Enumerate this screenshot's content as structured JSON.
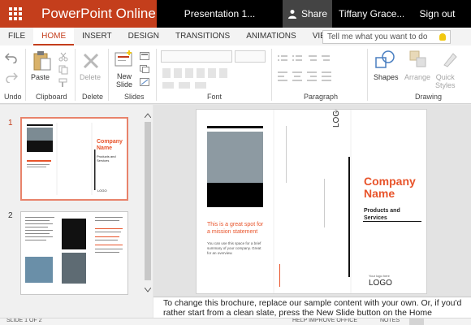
{
  "titlebar": {
    "app_name": "PowerPoint Online",
    "doc_name": "Presentation 1...",
    "share_label": "Share",
    "user_name": "Tiffany Grace...",
    "signout_label": "Sign out"
  },
  "tabs": [
    "FILE",
    "HOME",
    "INSERT",
    "DESIGN",
    "TRANSITIONS",
    "ANIMATIONS",
    "VIEW"
  ],
  "active_tab": "HOME",
  "tellme_placeholder": "Tell me what you want to do",
  "ribbon": {
    "undo_label": "Undo",
    "paste_label": "Paste",
    "clipboard_label": "Clipboard",
    "delete_btn": "Delete",
    "delete_group": "Delete",
    "new_slide_1": "New",
    "new_slide_2": "Slide",
    "slides_group": "Slides",
    "font_group": "Font",
    "paragraph_group": "Paragraph",
    "shapes_label": "Shapes",
    "arrange_label": "Arrange",
    "quick_styles_1": "Quick",
    "quick_styles_2": "Styles",
    "drawing_group": "Drawing"
  },
  "thumbnails": [
    {
      "number": "1",
      "company": "Company Name",
      "sub": "Products and Services",
      "logo": "LOGO"
    },
    {
      "number": "2"
    }
  ],
  "slide": {
    "company_name_1": "Company",
    "company_name_2": "Name",
    "products": "Products and Services",
    "mission": "This is a great spot for a mission statement",
    "body_text": "You can use this space for a brief summary of your company. Great for an overview.",
    "logo_top": "LOGO",
    "logo_bottom": "LOGO",
    "your_logo": "Your logo here"
  },
  "notes_text": "To change this brochure, replace our sample content with your own. Or, if you'd rather start from a clean slate, press the New Slide button on the Home",
  "status": {
    "slide_info": "SLIDE 1 OF 2",
    "help_text": "HELP IMPROVE OFFICE",
    "notes_label": "NOTES"
  },
  "colors": {
    "brand": "#c43e1c",
    "accent_orange": "#e8542b"
  }
}
